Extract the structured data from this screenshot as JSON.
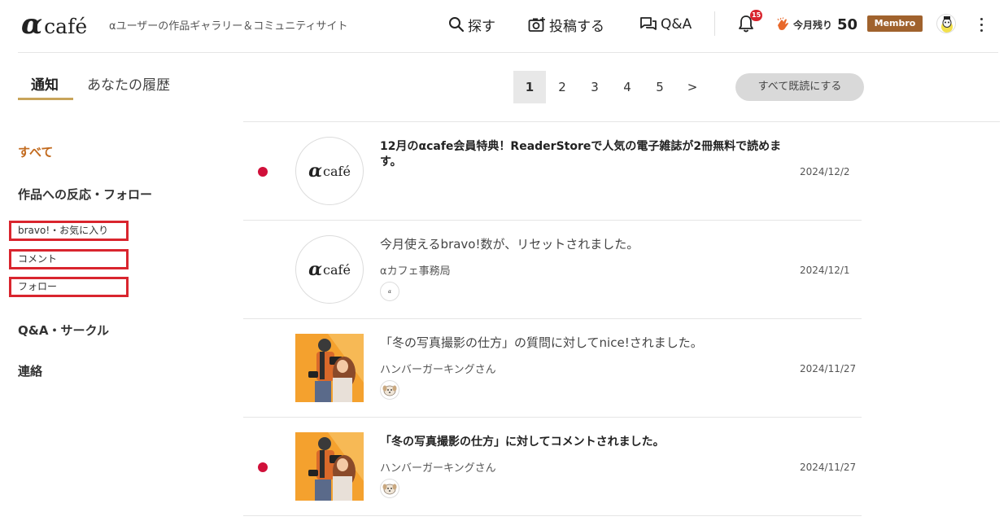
{
  "header": {
    "logo_alpha": "α",
    "logo_cafe": "café",
    "tagline": "αユーザーの作品ギャラリー＆コミュニティサイト",
    "nav": {
      "search": "探す",
      "post": "投稿する",
      "qa": "Q&A"
    },
    "bell_badge": "15",
    "remain_label": "今月残り",
    "remain_count": "50",
    "membro": "Membro"
  },
  "tabs": {
    "notifications": "通知",
    "history": "あなたの履歴"
  },
  "pagination": {
    "pages": [
      "1",
      "2",
      "3",
      "4",
      "5"
    ],
    "next": ">",
    "current": "1"
  },
  "read_all_button": "すべて既読にする",
  "sidebar": {
    "all": "すべて",
    "reaction_follow": "作品への反応・フォロー",
    "bravo_favorite": "bravo!・お気に入り",
    "comment": "コメント",
    "follow": "フォロー",
    "qa_circle": "Q&A・サークル",
    "contact": "連絡"
  },
  "notifications": [
    {
      "title": "12月のαcafe会員特典！ReaderStoreで人気の電子雑誌が2冊無料で読めます。",
      "sender": "",
      "date": "2024/12/2",
      "unread": true
    },
    {
      "title": "今月使えるbravo!数が、リセットされました。",
      "sender": "αカフェ事務局",
      "date": "2024/12/1",
      "unread": false
    },
    {
      "title": "「冬の写真撮影の仕方」の質問に対してnice!されました。",
      "sender": "ハンバーガーキングさん",
      "date": "2024/11/27",
      "unread": false
    },
    {
      "title": "「冬の写真撮影の仕方」に対してコメントされました。",
      "sender": "ハンバーガーキングさん",
      "date": "2024/11/27",
      "unread": true
    }
  ],
  "colors": {
    "accent_orange": "#c26a1e",
    "unread_dot": "#d0103a",
    "membro_badge": "#a0622d",
    "highlight_border": "#d9252e"
  }
}
